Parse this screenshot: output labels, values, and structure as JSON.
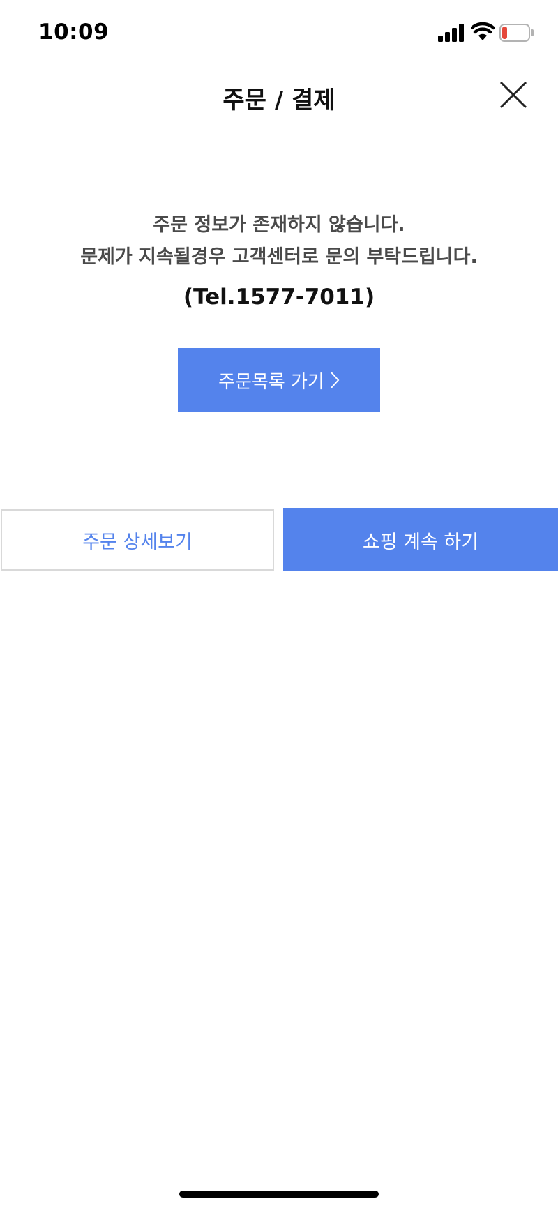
{
  "status_bar": {
    "time": "10:09",
    "icons": [
      "cellular-signal-icon",
      "wifi-icon",
      "battery-low-icon"
    ],
    "battery_color": "#e5483b"
  },
  "header": {
    "title": "주문 / 결제",
    "close_icon": "close-icon"
  },
  "message": {
    "line1": "주문 정보가 존재하지 않습니다.",
    "line2": "문제가 지속될경우 고객센터로 문의 부탁드립니다.",
    "tel": "(Tel.1577-7011)"
  },
  "buttons": {
    "order_list": "주문목록 가기",
    "order_detail": "주문 상세보기",
    "continue_shopping": "쇼핑 계속 하기"
  },
  "colors": {
    "accent": "#5483ec",
    "border": "#d9d9d9",
    "text_dark": "#111111",
    "text_gray": "#4a4a4a"
  }
}
